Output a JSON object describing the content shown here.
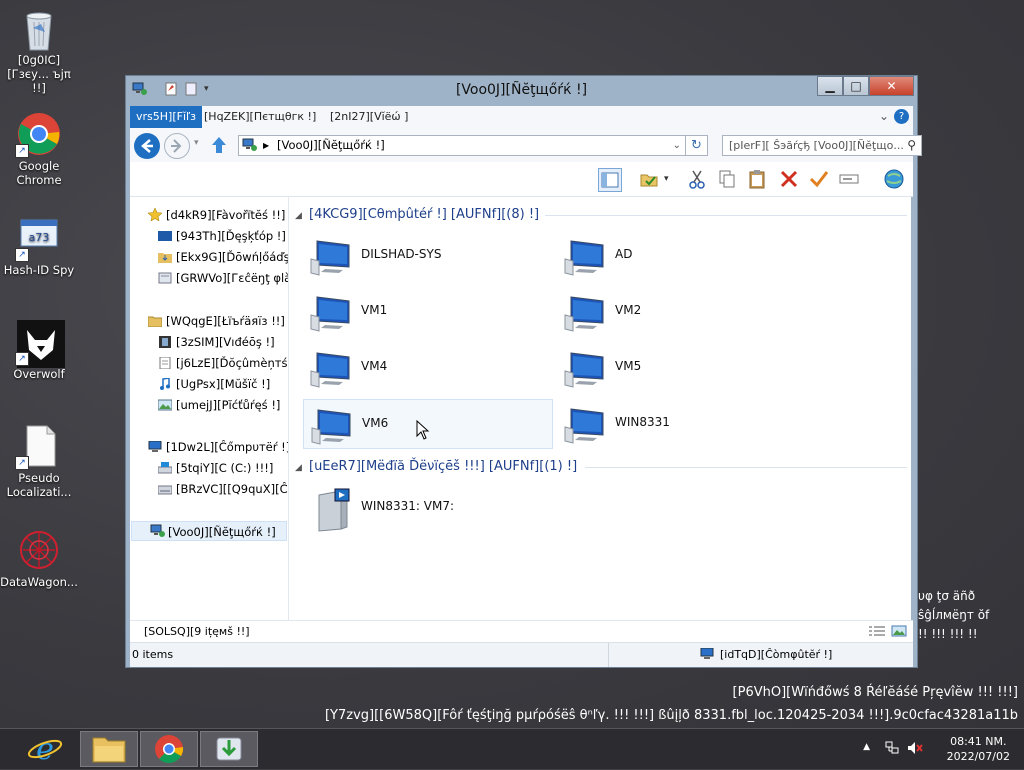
{
  "desktop": {
    "icons": [
      {
        "name": "recycle-bin",
        "label": "[0g0IC][Гзєу... ъјπ !!]"
      },
      {
        "name": "google-chrome",
        "label": "Google Chrome"
      },
      {
        "name": "hash-id-spy",
        "label": "Hash-ID Spy"
      },
      {
        "name": "overwolf",
        "label": "Overwolf"
      },
      {
        "name": "pseudo-localization",
        "label": "Pseudo Localizati..."
      },
      {
        "name": "datawagon",
        "label": "DataWagon..."
      }
    ],
    "overflow_text": [
      "υφ ţσ äñð",
      "ŝĝĺлмёŋт ŏf",
      "!! !!! !!! !!"
    ],
    "watermark": {
      "line1": "[P6VhO][Wïńđőwś 8 Ŕéľĕáśé Pŗęvîĕw !!! !!!]",
      "line2": "[Y7zvg][[6W58Q][Fôŕ ťęśţiŋğ pμŕρóśёŝ θⁿľγ. !!! !!!] ßûįļð 8331.fbl_loc.120425-2034 !!!].9c0cfac43281a11b"
    }
  },
  "taskbar": {
    "clock_time": "08:41 NM.",
    "clock_date": "2022/07/02"
  },
  "window": {
    "title": "[Voo0J][Ñĕţщőŕќ !]",
    "ribbon": {
      "file_tab": "vrs5H][Fĭľз",
      "tabs": [
        "[HqZEK][Пєтщθгк !]",
        "[2nI27][Vĭёώ ]"
      ]
    },
    "address": {
      "path": "[Voo0J][Ñĕţщőŕќ !]"
    },
    "search": {
      "placeholder": "[pIerF][ Ŝэăŕçђ [Voo0J][Ñĕţщо..."
    },
    "nav": {
      "favorites": "[d4kR9][Fàvořїtĕś !!]",
      "fav_items": [
        "[943Th][Ďęşķťóp !]",
        "[Ekx9G][Ďōwńļőáďş",
        "[GRWVo][Гεĉёŋţ φlà"
      ],
      "libraries": "[WQqgE][Łїъŕäяïз !!]",
      "lib_items": [
        "[3zSIM][Vıđéōş !]",
        "[j6LzE][Ďŏçûmèņтś !",
        "[UgPsx][Mŭšïč !]",
        "[umejJ][Pĭćťůŕęś !]"
      ],
      "computer": "[1Dw2L][Ĉőmpυтёŕ !]",
      "comp_items": [
        "[5tqiY][C (C:) !!!]",
        "[BRzVC][[Q9quX][ĈĎ"
      ],
      "network": "[Voo0J][Ñĕţщőŕќ !]"
    },
    "groups": {
      "computer_head": "[4KCG9][Cθmþûtéŕ !] [AUFNf][(8) !]",
      "computers": [
        "DILSHAD-SYS",
        "AD",
        "VM1",
        "VM2",
        "VM4",
        "VM5",
        "VM6",
        "WIN8331"
      ],
      "media_head": "[uEeR7][Mёđïă Ďёνïçēš !!!] [AUFNf][(1) !]",
      "media": [
        "WIN8331: VM7:"
      ]
    },
    "status": {
      "items_count_label": "[SOLSQ][9 ițęмš !!]",
      "items": "0 items",
      "zone": "[idTqD][Ĉòmφûtĕŕ !]"
    }
  }
}
